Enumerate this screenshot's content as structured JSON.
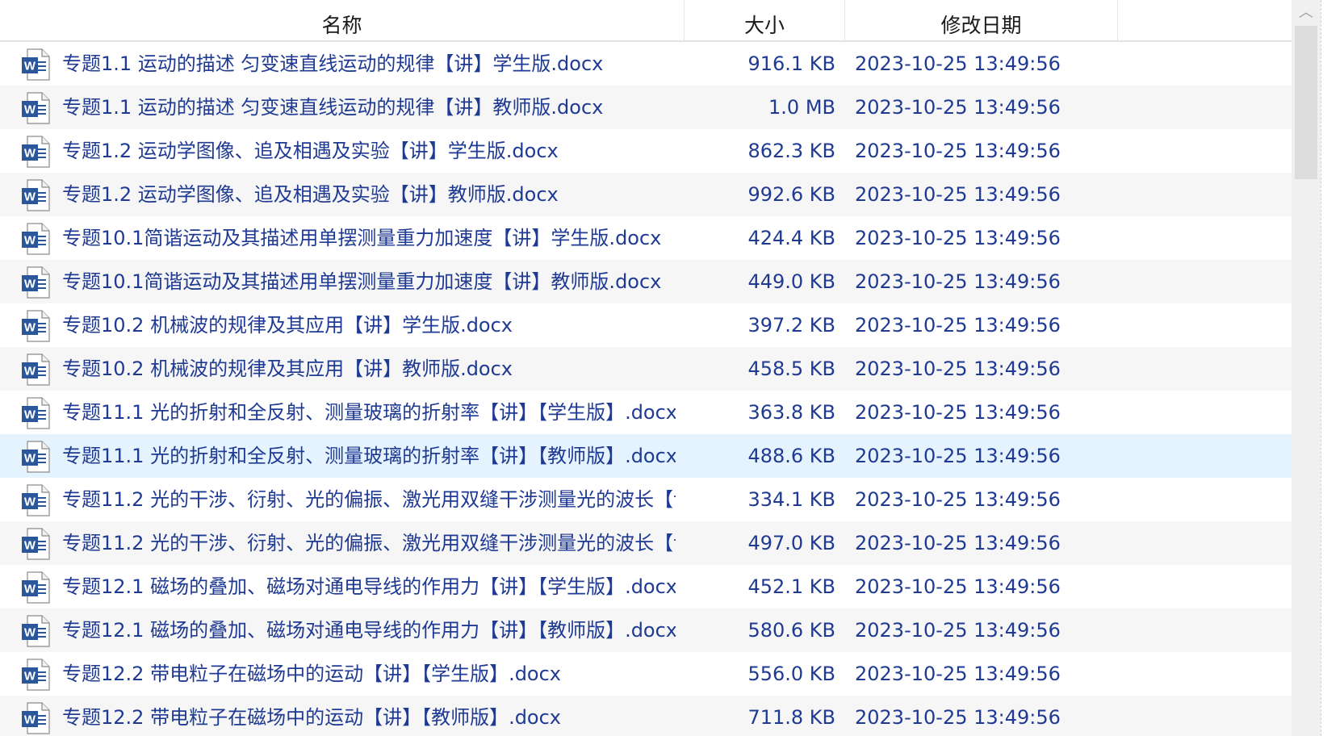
{
  "header": {
    "name": "名称",
    "size": "大小",
    "date": "修改日期"
  },
  "scrollbar": {
    "up_icon": "chevron-up-icon",
    "position": 0.0
  },
  "files": [
    {
      "name": "专题1.1 运动的描述 匀变速直线运动的规律【讲】学生版.docx",
      "size": "916.1 KB",
      "date": "2023-10-25 13:49:56"
    },
    {
      "name": "专题1.1 运动的描述 匀变速直线运动的规律【讲】教师版.docx",
      "size": "1.0 MB",
      "date": "2023-10-25 13:49:56"
    },
    {
      "name": "专题1.2 运动学图像、追及相遇及实验【讲】学生版.docx",
      "size": "862.3 KB",
      "date": "2023-10-25 13:49:56"
    },
    {
      "name": "专题1.2 运动学图像、追及相遇及实验【讲】教师版.docx",
      "size": "992.6 KB",
      "date": "2023-10-25 13:49:56"
    },
    {
      "name": "专题10.1简谐运动及其描述用单摆测量重力加速度【讲】学生版.docx",
      "size": "424.4 KB",
      "date": "2023-10-25 13:49:56"
    },
    {
      "name": "专题10.1简谐运动及其描述用单摆测量重力加速度【讲】教师版.docx",
      "size": "449.0 KB",
      "date": "2023-10-25 13:49:56"
    },
    {
      "name": "专题10.2 机械波的规律及其应用【讲】学生版.docx",
      "size": "397.2 KB",
      "date": "2023-10-25 13:49:56"
    },
    {
      "name": "专题10.2 机械波的规律及其应用【讲】教师版.docx",
      "size": "458.5 KB",
      "date": "2023-10-25 13:49:56"
    },
    {
      "name": "专题11.1 光的折射和全反射、测量玻璃的折射率【讲】【学生版】.docx",
      "size": "363.8 KB",
      "date": "2023-10-25 13:49:56"
    },
    {
      "name": "专题11.1 光的折射和全反射、测量玻璃的折射率【讲】【教师版】.docx",
      "size": "488.6 KB",
      "date": "2023-10-25 13:49:56"
    },
    {
      "name": "专题11.2 光的干涉、衍射、光的偏振、激光用双缝干涉测量光的波长【讠",
      "size": "334.1 KB",
      "date": "2023-10-25 13:49:56"
    },
    {
      "name": "专题11.2 光的干涉、衍射、光的偏振、激光用双缝干涉测量光的波长【讠",
      "size": "497.0 KB",
      "date": "2023-10-25 13:49:56"
    },
    {
      "name": "专题12.1 磁场的叠加、磁场对通电导线的作用力【讲】【学生版】.docx",
      "size": "452.1 KB",
      "date": "2023-10-25 13:49:56"
    },
    {
      "name": "专题12.1 磁场的叠加、磁场对通电导线的作用力【讲】【教师版】.docx",
      "size": "580.6 KB",
      "date": "2023-10-25 13:49:56"
    },
    {
      "name": "专题12.2 带电粒子在磁场中的运动【讲】【学生版】.docx",
      "size": "556.0 KB",
      "date": "2023-10-25 13:49:56"
    },
    {
      "name": "专题12.2 带电粒子在磁场中的运动【讲】【教师版】.docx",
      "size": "711.8 KB",
      "date": "2023-10-25 13:49:56"
    }
  ],
  "file_icon": "word-document-icon",
  "colors": {
    "text": "#1f3a93",
    "selected_row": "#e5f3ff",
    "alt_row": "#f6f6f6",
    "word_blue": "#2b579a"
  }
}
